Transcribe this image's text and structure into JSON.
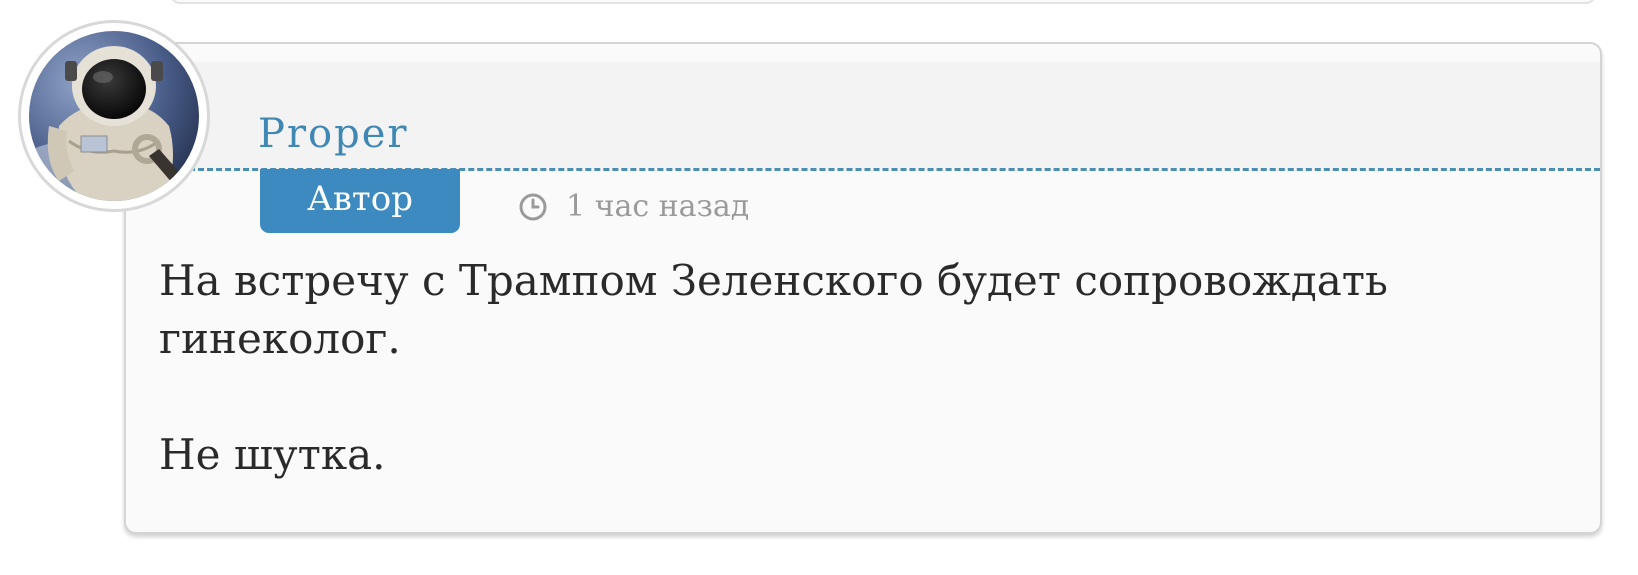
{
  "comment": {
    "author": "Proper",
    "role_badge": "Автор",
    "timestamp": "1 час назад",
    "body_line1": "На встречу с Трампом Зеленского будет сопровождать гинеколог.",
    "body_line2": "Не шутка.",
    "icons": {
      "time": "clock-icon",
      "avatar": "astronaut-avatar"
    },
    "colors": {
      "accent": "#3e88b3",
      "badge": "#3d8ac1",
      "muted": "#9a9a9a",
      "text": "#2a2a2a"
    }
  }
}
